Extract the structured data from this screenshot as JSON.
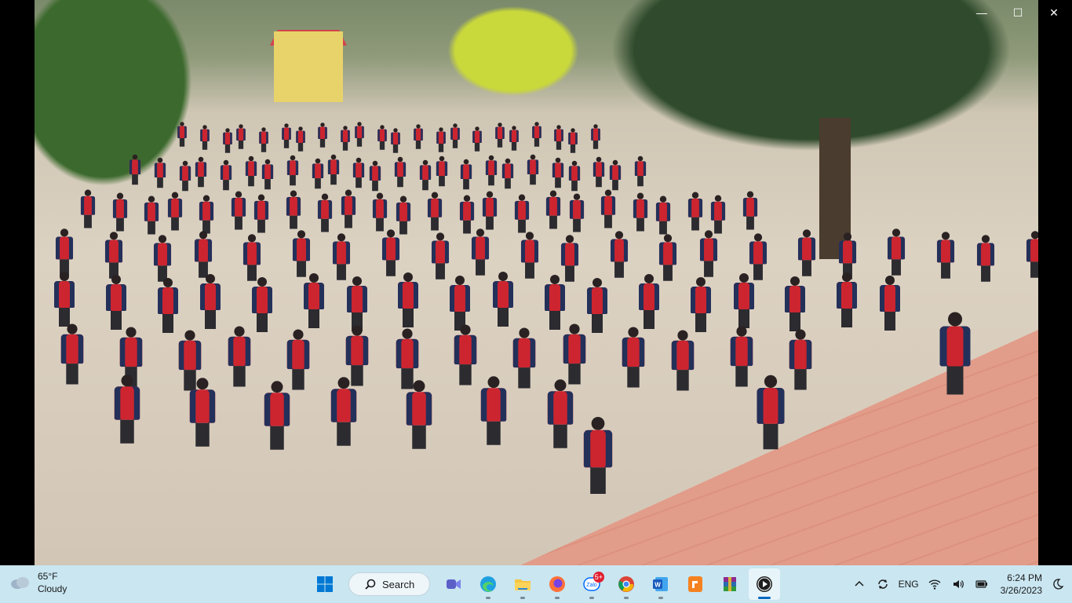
{
  "window": {
    "controls": {
      "minimize": "—",
      "maximize": "☐",
      "close": "✕"
    }
  },
  "taskbar": {
    "weather": {
      "temp": "65°F",
      "condition": "Cloudy",
      "icon": "cloud-icon"
    },
    "search": {
      "label": "Search",
      "icon": "search-icon"
    },
    "apps": [
      {
        "name": "windows-start",
        "icon": "windows-logo-icon"
      },
      {
        "name": "meet",
        "icon": "video-camera-icon"
      },
      {
        "name": "edge",
        "icon": "edge-browser-icon"
      },
      {
        "name": "file-explorer",
        "icon": "folder-icon"
      },
      {
        "name": "firefox",
        "icon": "firefox-icon"
      },
      {
        "name": "zalo",
        "icon": "zalo-icon",
        "badge": "5+"
      },
      {
        "name": "chrome",
        "icon": "chrome-icon"
      },
      {
        "name": "word",
        "icon": "word-icon"
      },
      {
        "name": "pdf-reader",
        "icon": "pdf-icon"
      },
      {
        "name": "winrar",
        "icon": "winrar-icon"
      },
      {
        "name": "media-player",
        "icon": "play-icon"
      }
    ],
    "tray": {
      "language": "ENG",
      "time": "6:24 PM",
      "date": "3/26/2023"
    }
  },
  "colors": {
    "taskbar_bg": "#c9e6f1",
    "jacket_red": "#cc2530",
    "jacket_navy": "#23305a",
    "accent": "#0067c0"
  }
}
